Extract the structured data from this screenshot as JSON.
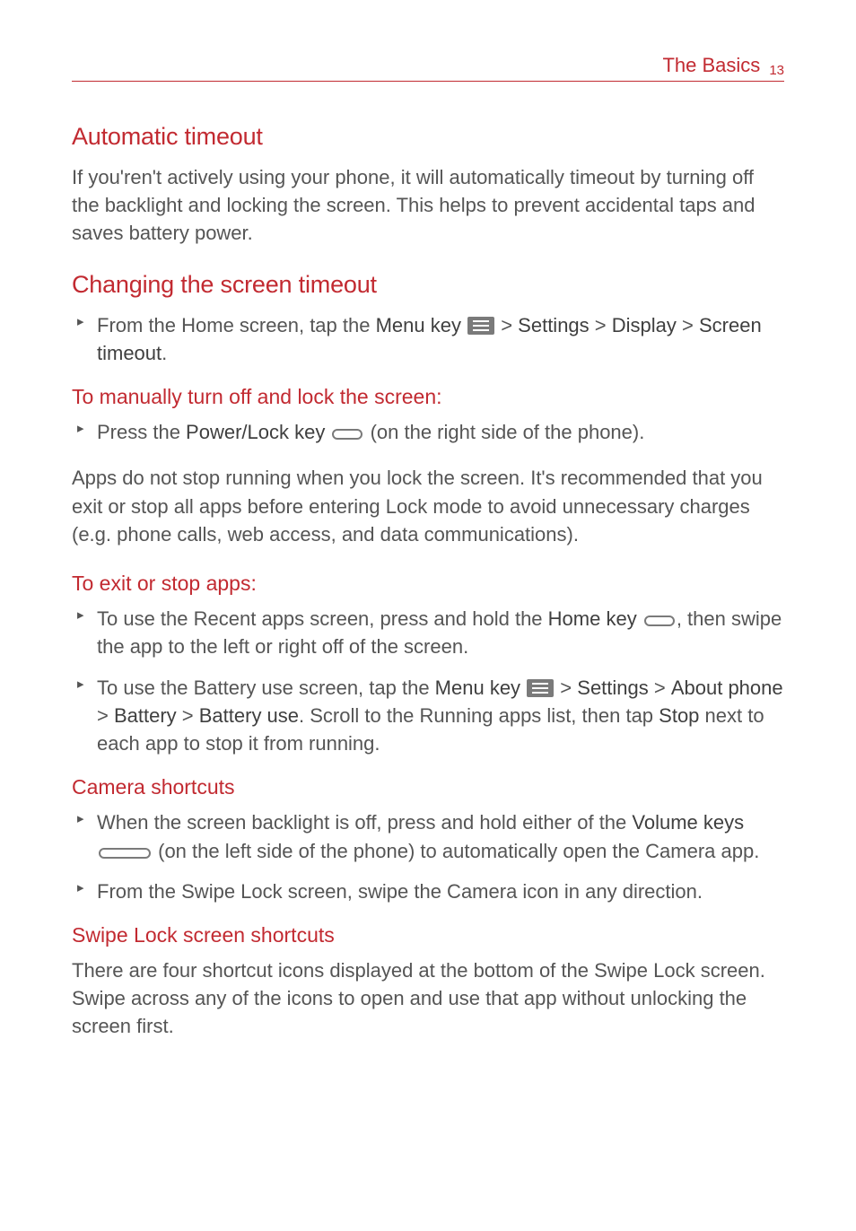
{
  "header": {
    "breadcrumb": "The Basics",
    "page_num": "13"
  },
  "s1": {
    "title": "Automatic timeout",
    "body": "If you'ren't actively using your phone, it will automatically timeout by turning off the backlight and locking the screen. This helps to prevent accidental taps and saves battery power."
  },
  "s2": {
    "title": "Changing the screen timeout",
    "b1a": "From the Home screen, tap the ",
    "b1b": "Menu key",
    "b1c": " > ",
    "b1d": "Settings",
    "b1e": " > ",
    "b1f": "Display",
    "b1g": " > ",
    "b1h": "Screen timeout",
    "b1i": "."
  },
  "s3": {
    "title": "To manually turn off and lock the screen:",
    "b1a": "Press the ",
    "b1b": "Power/Lock key",
    "b1c": " (on the right side of the phone).",
    "body": "Apps do not stop running when you lock the screen. It's recommended that you exit or stop all apps before entering Lock mode to avoid unnecessary charges (e.g. phone calls, web access, and data communications)."
  },
  "s4": {
    "title": "To exit or stop apps:",
    "b1a": "To use the Recent apps screen, press and hold the ",
    "b1b": "Home key",
    "b1c": ", then swipe the app to the left or right off of the screen.",
    "b2a": "To use the Battery use screen, tap the ",
    "b2b": "Menu key",
    "b2c": " > ",
    "b2d": "Settings",
    "b2e": " > ",
    "b2f": "About phone",
    "b2g": " > ",
    "b2h": "Battery",
    "b2i": " > ",
    "b2j": "Battery use",
    "b2k": ". Scroll to the Running apps list, then tap ",
    "b2l": "Stop",
    "b2m": " next to each app to stop it from running."
  },
  "s5": {
    "title": "Camera shortcuts",
    "b1a": "When the screen backlight is off, press and hold either of the ",
    "b1b": "Volume keys",
    "b1c": " (on the left side of the phone) to automatically open the Camera app.",
    "b2": "From the Swipe Lock screen, swipe the Camera icon in any direction."
  },
  "s6": {
    "title": "Swipe Lock screen shortcuts",
    "body": "There are four shortcut icons displayed at the bottom of the Swipe Lock screen. Swipe across any of the icons to open and use that app without unlocking the screen first."
  }
}
